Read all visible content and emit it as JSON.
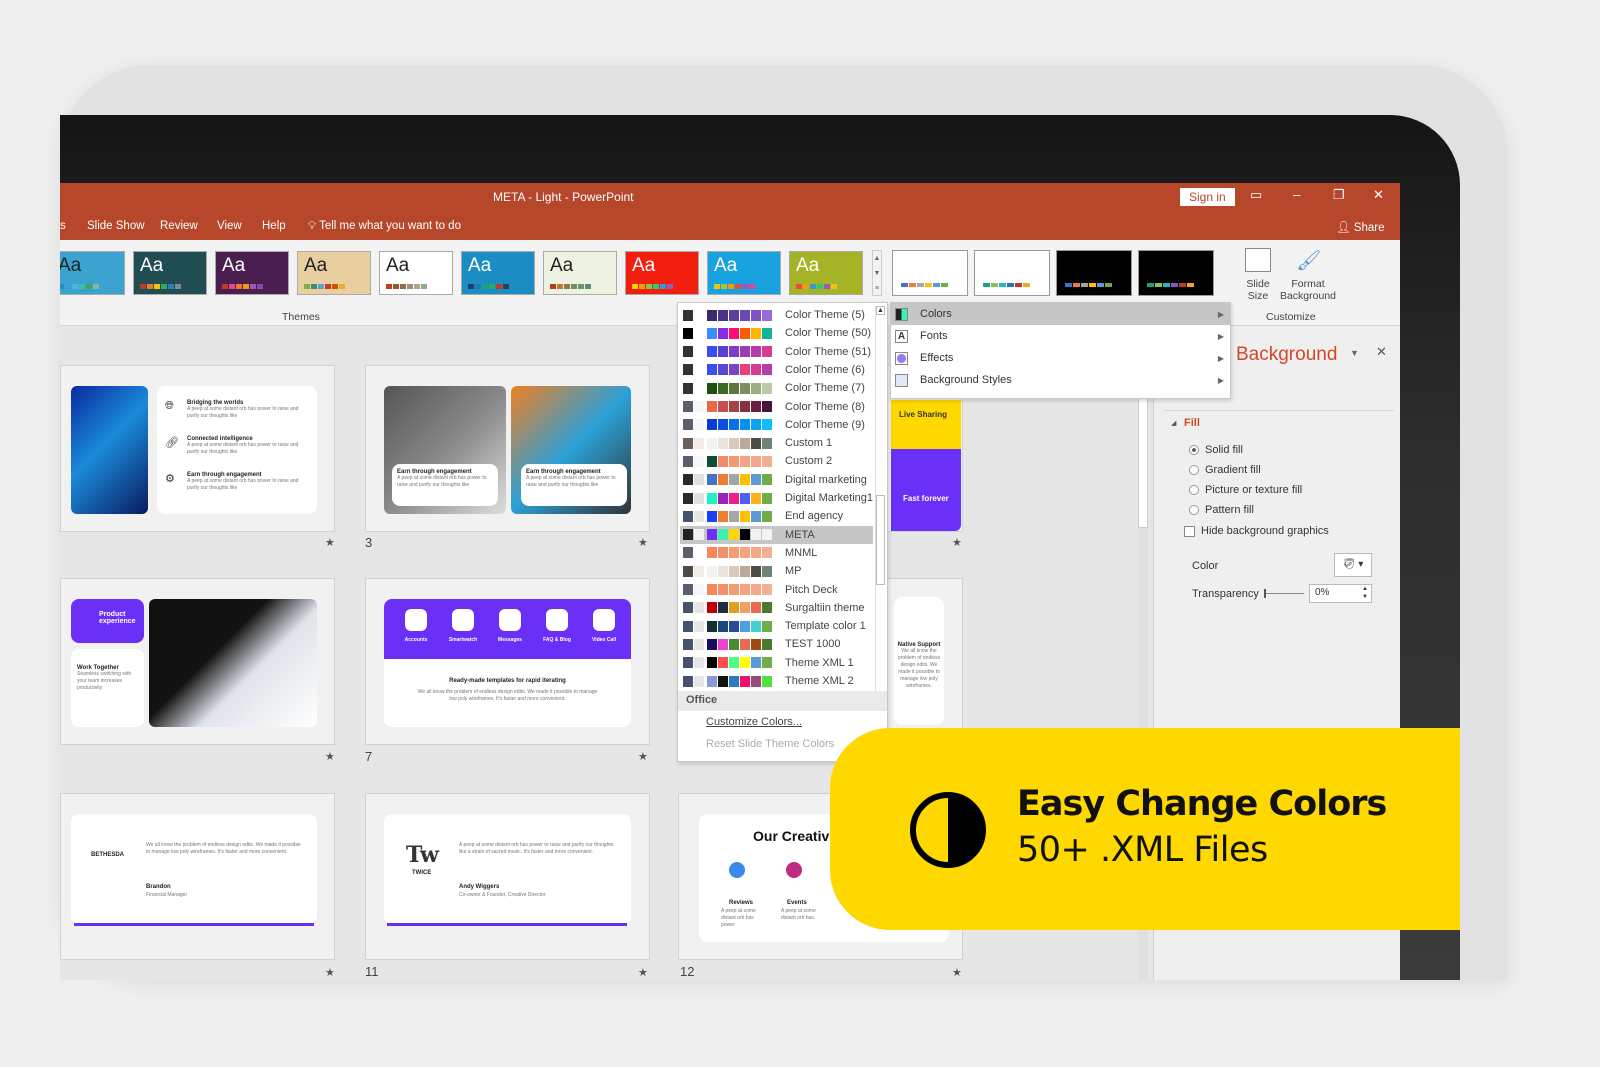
{
  "window": {
    "title": "META - Light  -  PowerPoint",
    "sign_in": "Sign in",
    "share": "Share"
  },
  "tabs": [
    "s",
    "Slide Show",
    "Review",
    "View",
    "Help"
  ],
  "tell_me": "Tell me what you want to do",
  "themes": {
    "label": "Themes",
    "items": [
      {
        "aa": "Aa",
        "bg": "#3aa3cf",
        "fg": "#222",
        "sw": [
          "#2b8fc0",
          "#37a6d4",
          "#48b9d8",
          "#3dbfae",
          "#4a9e6b",
          "#7dbb9a"
        ]
      },
      {
        "aa": "Aa",
        "bg": "#1f4d52",
        "fg": "#fff",
        "sw": [
          "#c0392b",
          "#e67e22",
          "#f1c40f",
          "#27ae60",
          "#2980b9",
          "#7f8c8d"
        ]
      },
      {
        "aa": "Aa",
        "bg": "#4a1f50",
        "fg": "#fff",
        "sw": [
          "#c0392b",
          "#e84393",
          "#e67e22",
          "#f39c12",
          "#9b59b6",
          "#8e44ad"
        ]
      },
      {
        "aa": "Aa",
        "bg": "#e9cfa0",
        "fg": "#222",
        "sw": [
          "#7fae4a",
          "#3a8f7a",
          "#5aa4c8",
          "#c0392b",
          "#d35400",
          "#e1b12c"
        ]
      },
      {
        "aa": "Aa",
        "bg": "#ffffff",
        "fg": "#222",
        "sw": [
          "#c0392b",
          "#a0522d",
          "#8b6e4e",
          "#9b8e7e",
          "#b1a18a",
          "#8fa88a"
        ]
      },
      {
        "aa": "Aa",
        "bg": "#1c8dc2",
        "fg": "#fff",
        "sw": [
          "#1d3f73",
          "#1a7fb5",
          "#17a589",
          "#27ae60",
          "#c0392b",
          "#2c3e50"
        ]
      },
      {
        "aa": "Aa",
        "bg": "#eef2e0",
        "fg": "#222",
        "sw": [
          "#b33b1e",
          "#c17a2a",
          "#8a7a4a",
          "#7a8a5a",
          "#6a9a6a",
          "#5a8a7a"
        ]
      },
      {
        "aa": "Aa",
        "bg": "#f21f0f",
        "fg": "#fff",
        "sw": [
          "#ffd400",
          "#f39c12",
          "#8bc34a",
          "#2ecc71",
          "#3498db",
          "#9b59b6"
        ]
      },
      {
        "aa": "Aa",
        "bg": "#18a3e0",
        "fg": "#fff",
        "sw": [
          "#f1c40f",
          "#a4c639",
          "#f39c12",
          "#e74c3c",
          "#9b59b6",
          "#e84393"
        ]
      },
      {
        "aa": "Aa",
        "bg": "#a5b427",
        "fg": "#fff",
        "sw": [
          "#e74c3c",
          "#f39c12",
          "#3498db",
          "#2ecc71",
          "#9b59b6",
          "#f1c40f"
        ]
      }
    ]
  },
  "variants": [
    {
      "bg": "#ffffff",
      "sw": [
        "#4472c4",
        "#ed7d31",
        "#a5a5a5",
        "#ffc000",
        "#5b9bd5",
        "#70ad47"
      ]
    },
    {
      "bg": "#ffffff",
      "sw": [
        "#1f9e89",
        "#8bc34a",
        "#26b5c7",
        "#1f77b4",
        "#c0392b",
        "#f5a623"
      ]
    },
    {
      "bg": "#000000",
      "sw": [
        "#4472c4",
        "#ed7d31",
        "#a5a5a5",
        "#ffc000",
        "#5b9bd5",
        "#70ad47"
      ]
    },
    {
      "bg": "#000000",
      "sw": [
        "#1f9e89",
        "#8bc34a",
        "#26b5c7",
        "#7b57c8",
        "#c0392b",
        "#f5a623"
      ]
    }
  ],
  "customize": {
    "label": "Customize",
    "slide_size": "Slide Size",
    "format_background": "Format Background"
  },
  "color_themes": [
    {
      "name": "Color Theme (5)",
      "c": [
        "#333",
        "#fff",
        "#3a2a6a",
        "#4a3488",
        "#5c3e9e",
        "#6c48b4",
        "#7e55c8",
        "#9a6ad8"
      ]
    },
    {
      "name": "Color Theme (50)",
      "c": [
        "#000",
        "#fff",
        "#3a8cff",
        "#8a2be2",
        "#ff0a78",
        "#ff5a00",
        "#ffb400",
        "#10b39a"
      ]
    },
    {
      "name": "Color Theme (51)",
      "c": [
        "#333",
        "#fff",
        "#3a4df0",
        "#5840d8",
        "#7a3ec8",
        "#9a3cb8",
        "#b83ca8",
        "#d83c90"
      ]
    },
    {
      "name": "Color Theme (6)",
      "c": [
        "#333",
        "#fff",
        "#3a4df0",
        "#5848d8",
        "#7a44c8",
        "#e8407a",
        "#d83c90",
        "#b83ca8"
      ]
    },
    {
      "name": "Color Theme (7)",
      "c": [
        "#333",
        "#fff",
        "#1e4e10",
        "#3a6a24",
        "#587a3e",
        "#7a9060",
        "#9aae86",
        "#bcc8aa"
      ]
    },
    {
      "name": "Color Theme (8)",
      "c": [
        "#5a5f70",
        "#f4f6fa",
        "#e8684a",
        "#c8504a",
        "#a84048",
        "#8a2e44",
        "#6a2040",
        "#4a1438"
      ]
    },
    {
      "name": "Color Theme (9)",
      "c": [
        "#5a5f70",
        "#f4f6fa",
        "#0a3ad8",
        "#0a50e8",
        "#0a6ef0",
        "#0a8ef0",
        "#0aa6f4",
        "#10bef8"
      ]
    },
    {
      "name": "Custom 1",
      "c": [
        "#6a625a",
        "#f0ece6",
        "#f4f2ee",
        "#ece4dc",
        "#dcc8b8",
        "#bca898",
        "#4e4a44",
        "#6e8478"
      ]
    },
    {
      "name": "Custom 2",
      "c": [
        "#5a5f70",
        "#f4f6fa",
        "#0a5030",
        "#f4886a",
        "#f4986e",
        "#f4a482",
        "#f4a88a",
        "#f4ae92"
      ]
    },
    {
      "name": "Digital marketing",
      "c": [
        "#2a2a2a",
        "#e0e0e0",
        "#4472c4",
        "#ed7d31",
        "#a5a5a5",
        "#ffc000",
        "#5b9bd5",
        "#70ad47"
      ]
    },
    {
      "name": "Digital Marketing1",
      "c": [
        "#2a2a2a",
        "#e0e0e0",
        "#20f0c8",
        "#9a20c0",
        "#f01a8a",
        "#4a60f8",
        "#ffb020",
        "#70ad47"
      ]
    },
    {
      "name": "End agency",
      "c": [
        "#44546a",
        "#e7e6e6",
        "#1a40f8",
        "#ed7d31",
        "#a5a5a5",
        "#ffc000",
        "#5b9bd5",
        "#70ad47"
      ]
    },
    {
      "name": "META",
      "c": [
        "#222",
        "#f2f2f2",
        "#6a30f8",
        "#40f0b0",
        "#ffd800",
        "#000",
        "#f2f2f2",
        "#f2f2f2"
      ]
    },
    {
      "name": "MNML",
      "c": [
        "#5a5f70",
        "#fff",
        "#f4885a",
        "#f49068",
        "#f49c74",
        "#f4a480",
        "#f4aa8a",
        "#f4b094"
      ]
    },
    {
      "name": "MP",
      "c": [
        "#4e4a44",
        "#f0ece6",
        "#f4f2ee",
        "#ece4dc",
        "#dcc8b8",
        "#bca898",
        "#4e4a44",
        "#6e8478"
      ]
    },
    {
      "name": "Pitch Deck",
      "c": [
        "#5a5f70",
        "#f4f6fa",
        "#f4885a",
        "#f49068",
        "#f49c74",
        "#f4a480",
        "#f4aa8a",
        "#f4b094"
      ]
    },
    {
      "name": "Surgaltiin theme",
      "c": [
        "#44546a",
        "#e7e6e6",
        "#c00000",
        "#1a3040",
        "#e0a020",
        "#f0a060",
        "#e86a50",
        "#4a7a30"
      ]
    },
    {
      "name": "Template color 1",
      "c": [
        "#44546a",
        "#e7e6e6",
        "#143030",
        "#1a4a7a",
        "#2a4a9a",
        "#4aa0e0",
        "#40d0d0",
        "#70ad47"
      ]
    },
    {
      "name": "TEST 1000",
      "c": [
        "#44546a",
        "#e7e6e6",
        "#1a0a60",
        "#f040d0",
        "#4a8a30",
        "#e86a50",
        "#a04a10",
        "#4a7a30"
      ]
    },
    {
      "name": "Theme XML 1",
      "c": [
        "#44546a",
        "#e7e6e6",
        "#000",
        "#ff5050",
        "#50ff80",
        "#ffff00",
        "#5b9bd5",
        "#70ad47"
      ]
    },
    {
      "name": "Theme XML 2",
      "c": [
        "#44546a",
        "#e7e6e6",
        "#8a9ad8",
        "#111",
        "#2a7ac0",
        "#f0106a",
        "#9a4a7a",
        "#50e040"
      ]
    }
  ],
  "selected_theme": "META",
  "colors_footer": {
    "section": "Office",
    "customize": "Customize Colors...",
    "reset": "Reset Slide Theme Colors"
  },
  "design_menu": [
    {
      "label": "Colors",
      "icon": "colors-icon"
    },
    {
      "label": "Fonts",
      "icon": "fonts-icon"
    },
    {
      "label": "Effects",
      "icon": "effects-icon"
    },
    {
      "label": "Background Styles",
      "icon": "background-styles-icon"
    }
  ],
  "format_panel": {
    "title": "Background",
    "section": "Fill",
    "options": [
      "Solid fill",
      "Gradient fill",
      "Picture or texture fill",
      "Pattern fill"
    ],
    "selected": "Solid fill",
    "hide_graphics": "Hide background graphics",
    "hide_checked": false,
    "color_label": "Color",
    "transparency_label": "Transparency",
    "transparency_value": "0%"
  },
  "slides": {
    "s2": {
      "items": [
        {
          "t": "Bridging the worlds",
          "d": "A peep at some distant orb has power to raise and purify our thoughts like"
        },
        {
          "t": "Connected intelligence",
          "d": "A peep at some distant orb has power to raise and purify our thoughts like"
        },
        {
          "t": "Earn through engagement",
          "d": "A peep at some distant orb has power to raise and purify our thoughts like"
        }
      ]
    },
    "s3": {
      "num": "3",
      "cards": [
        {
          "t": "Earn through engagement",
          "d": "A peep at some distant orb has power to raise and purify our thoughts like"
        },
        {
          "t": "Earn through engagement",
          "d": "A peep at some distant orb has power to raise and purify our thoughts like"
        }
      ]
    },
    "s6": {
      "product": "Product experience",
      "work": "Work Together",
      "work_d": "Seamless switching with your team increases productivity"
    },
    "s7": {
      "num": "7",
      "icons": [
        "Accounts",
        "Smartwatch",
        "Messages",
        "FAQ & Blog",
        "Video Call"
      ],
      "title": "Ready-made templates for rapid iterating",
      "desc": "We all know the problem of endless design edits. We made it possible to manage low poly wireframes. It's faster and more convenient."
    },
    "s8": {
      "live": "Live Sharing",
      "fast": "Fast forever",
      "native": "Native Support",
      "native_d": "We all know the problem of endless design edits. We made it possible to manage low poly wireframes."
    },
    "s10": {
      "logo": "BETHESDA",
      "quote": "We all know the problem of endless design edits. We made it possible to manage low poly wireframes. It's faster and more convenient.",
      "name": "Brandon",
      "role": "Financial Manager"
    },
    "s11": {
      "num": "11",
      "logo": "TWICE",
      "quote": "A peep at some distant orb has power to raise and purify our thoughts like a strain of sacred music. It's faster and more convenient.",
      "name": "Andy Wiggers",
      "role": "Co-owner & Founder, Creative Director"
    },
    "s12": {
      "num": "12",
      "title": "Our Creative",
      "cols": [
        {
          "t": "Reviews",
          "d": "A peep at some distant orb has power."
        },
        {
          "t": "Events",
          "d": "A peep at some distant orb has."
        }
      ]
    }
  },
  "banner": {
    "title": "Easy Change Colors",
    "subtitle": "50+ .XML Files",
    "bg": "#ffd800"
  },
  "accent": {
    "powerpoint": "#b7472a",
    "meta_purple": "#6a30f8"
  }
}
